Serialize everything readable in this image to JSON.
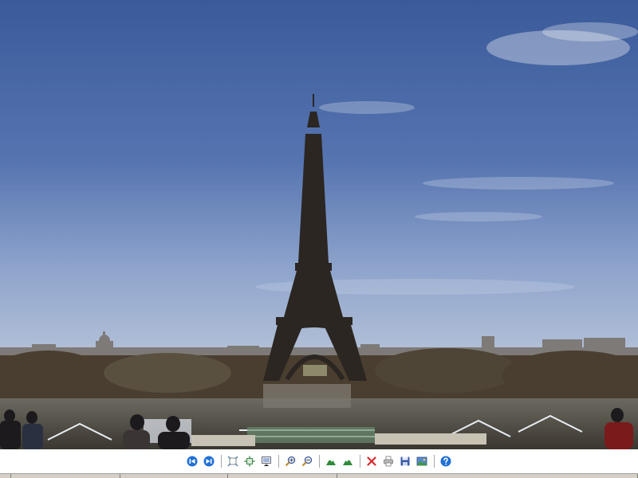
{
  "viewer": {
    "image_description_alt": "",
    "toolbar": {
      "buttons": [
        {
          "name": "previous-button",
          "icon": "previous-icon",
          "tooltip": ""
        },
        {
          "name": "next-button",
          "icon": "next-icon",
          "tooltip": ""
        },
        {
          "name": "best-fit-button",
          "icon": "best-fit-icon",
          "tooltip": ""
        },
        {
          "name": "actual-size-button",
          "icon": "actual-size-icon",
          "tooltip": ""
        },
        {
          "name": "slideshow-button",
          "icon": "slideshow-icon",
          "tooltip": ""
        },
        {
          "name": "zoom-in-button",
          "icon": "zoom-in-icon",
          "tooltip": ""
        },
        {
          "name": "zoom-out-button",
          "icon": "zoom-out-icon",
          "tooltip": ""
        },
        {
          "name": "rotate-clockwise-button",
          "icon": "rotate-clockwise-icon",
          "tooltip": ""
        },
        {
          "name": "rotate-counterclockwise-button",
          "icon": "rotate-counterclockwise-icon",
          "tooltip": ""
        },
        {
          "name": "delete-button",
          "icon": "delete-icon",
          "tooltip": ""
        },
        {
          "name": "print-button",
          "icon": "print-icon",
          "tooltip": ""
        },
        {
          "name": "save-button",
          "icon": "save-icon",
          "tooltip": ""
        },
        {
          "name": "open-editor-button",
          "icon": "edit-image-icon",
          "tooltip": ""
        },
        {
          "name": "help-button",
          "icon": "help-icon",
          "tooltip": ""
        }
      ]
    },
    "colors": {
      "sky_top": "#3f5f9e",
      "sky_bottom": "#9fb4d8",
      "nav_blue": "#1f6fd6",
      "delete_red": "#d8282f",
      "toolbar_bg": "#ffffff",
      "statusbar_bg": "#d4d0c8"
    }
  }
}
